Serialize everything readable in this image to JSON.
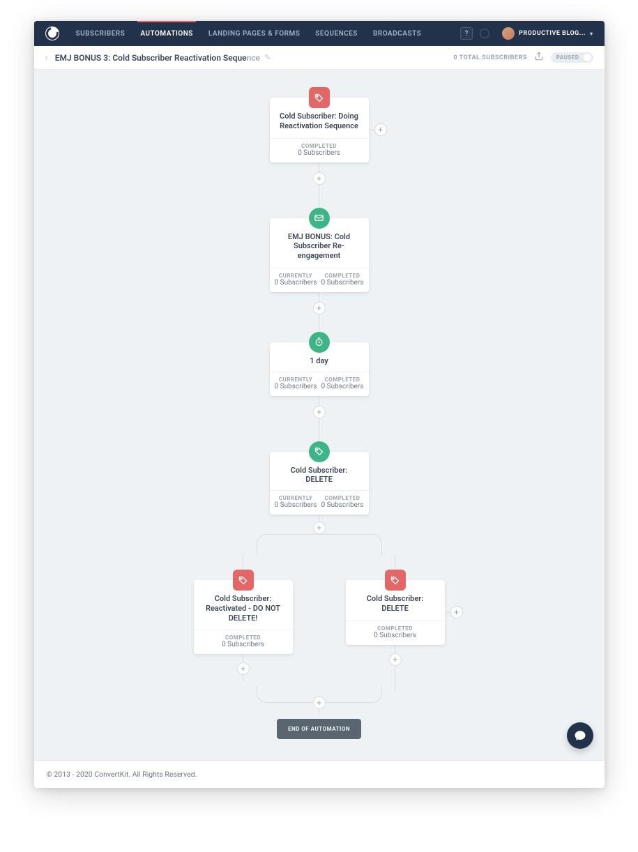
{
  "nav": {
    "items": [
      "SUBSCRIBERS",
      "AUTOMATIONS",
      "LANDING PAGES & FORMS",
      "SEQUENCES",
      "BROADCASTS"
    ],
    "active_index": 1,
    "help": "?",
    "user_name": "PRODUCTIVE BLOG..."
  },
  "subheader": {
    "title_main": "EMJ BONUS 3: Cold Subscriber Reactivation Seque",
    "title_faded": "nce",
    "total": "0 TOTAL SUBSCRIBERS",
    "status": "PAUSED"
  },
  "nodes": {
    "n1": {
      "title": "Cold Subscriber: Doing Reactivation Sequence",
      "stat_label": "COMPLETED",
      "stat_value": "0 Subscribers",
      "color": "red",
      "icon": "tag"
    },
    "n2": {
      "title": "EMJ BONUS: Cold Subscriber Re-engagement",
      "left_label": "CURRENTLY",
      "left_value": "0 Subscribers",
      "right_label": "COMPLETED",
      "right_value": "0 Subscribers",
      "color": "green",
      "icon": "mail"
    },
    "n3": {
      "title": "1 day",
      "left_label": "CURRENTLY",
      "left_value": "0 Subscribers",
      "right_label": "COMPLETED",
      "right_value": "0 Subscribers",
      "color": "green",
      "icon": "clock"
    },
    "n4": {
      "title": "Cold Subscriber: DELETE",
      "left_label": "CURRENTLY",
      "left_value": "0 Subscribers",
      "right_label": "COMPLETED",
      "right_value": "0 Subscribers",
      "color": "green",
      "icon": "tag"
    },
    "b1": {
      "title": "Cold Subscriber: Reactivated - DO NOT DELETE!",
      "stat_label": "COMPLETED",
      "stat_value": "0 Subscribers",
      "color": "red",
      "icon": "tag"
    },
    "b2": {
      "title": "Cold Subscriber: DELETE",
      "stat_label": "COMPLETED",
      "stat_value": "0 Subscribers",
      "color": "red",
      "icon": "tag"
    }
  },
  "end_label": "END OF AUTOMATION",
  "footer": "© 2013 - 2020 ConvertKit. All Rights Reserved."
}
